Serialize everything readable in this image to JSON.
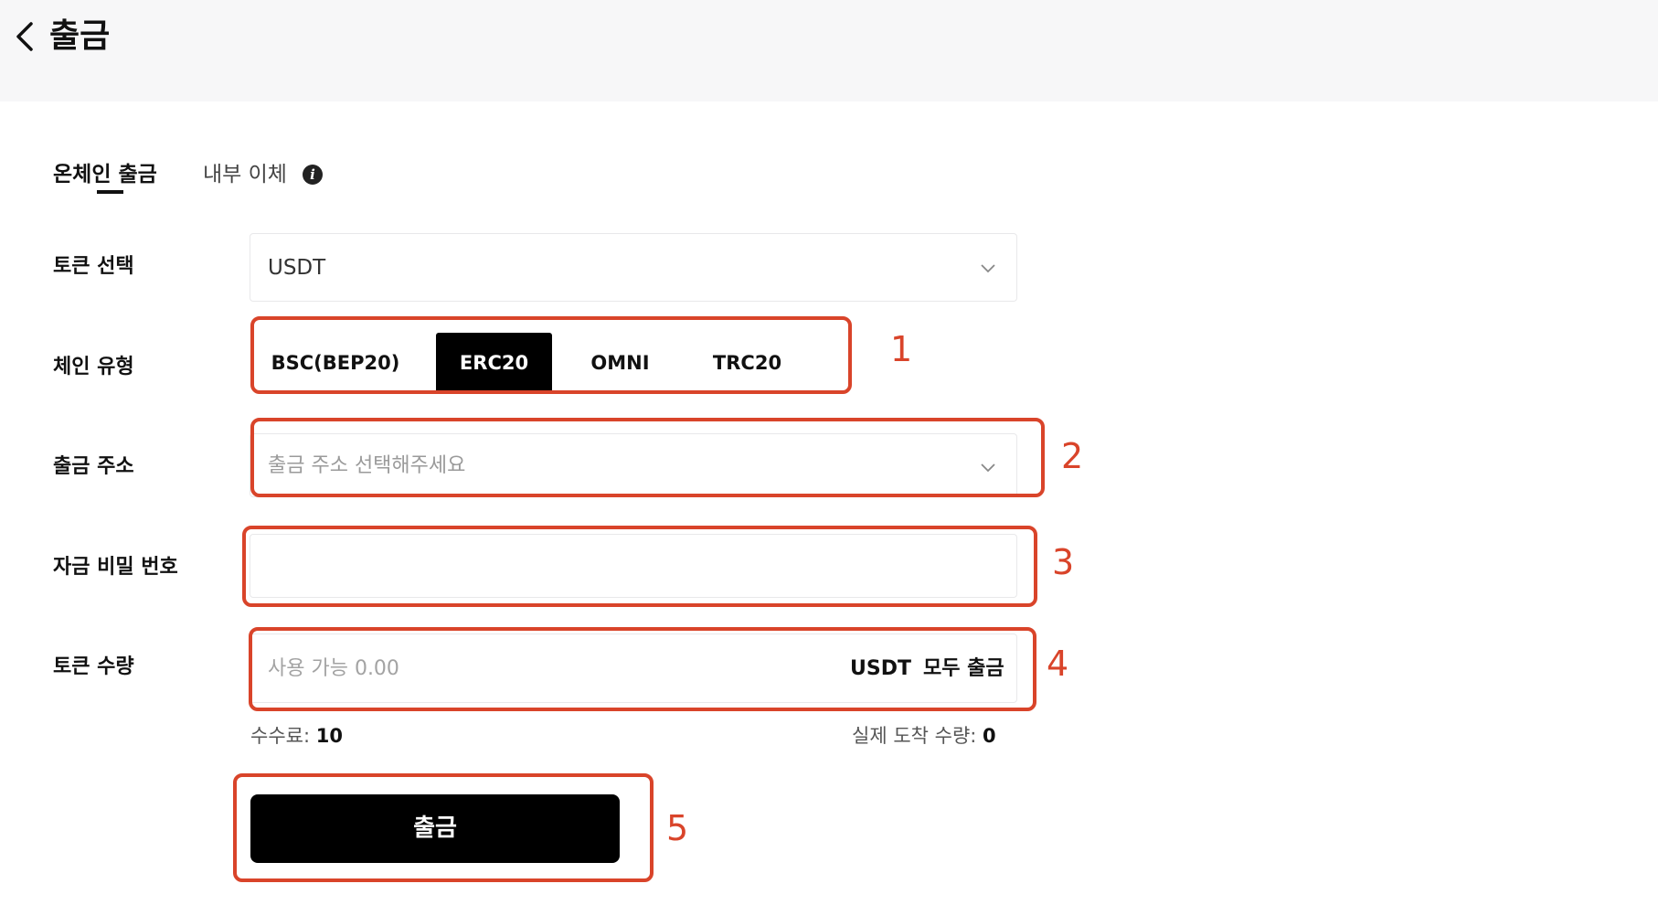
{
  "header": {
    "title": "출금",
    "back_icon": "chevron-left-icon"
  },
  "tabs": [
    {
      "label": "온체인 출금",
      "active": true
    },
    {
      "label": "내부 이체",
      "active": false,
      "icon": "info-icon"
    }
  ],
  "form": {
    "token": {
      "label": "토큰 선택",
      "value": "USDT"
    },
    "chain": {
      "label": "체인 유형",
      "options": [
        "BSC(BEP20)",
        "ERC20",
        "OMNI",
        "TRC20"
      ],
      "selected": "ERC20"
    },
    "address": {
      "label": "출금 주소",
      "placeholder": "출금 주소 선택해주세요"
    },
    "password": {
      "label": "자금 비밀 번호",
      "value": ""
    },
    "amount": {
      "label": "토큰 수량",
      "placeholder": "사용 가능 0.00",
      "unit": "USDT",
      "max_label": "모두 출금"
    },
    "fee": {
      "label": "수수료:",
      "value": "10"
    },
    "actual": {
      "label": "실제 도착 수량:",
      "value": "0"
    },
    "submit_label": "출금"
  },
  "annotations": [
    "1",
    "2",
    "3",
    "4",
    "5"
  ],
  "colors": {
    "annotation": "#d9442a",
    "active_chain": "#000000",
    "header_bg": "#f7f7f8"
  }
}
